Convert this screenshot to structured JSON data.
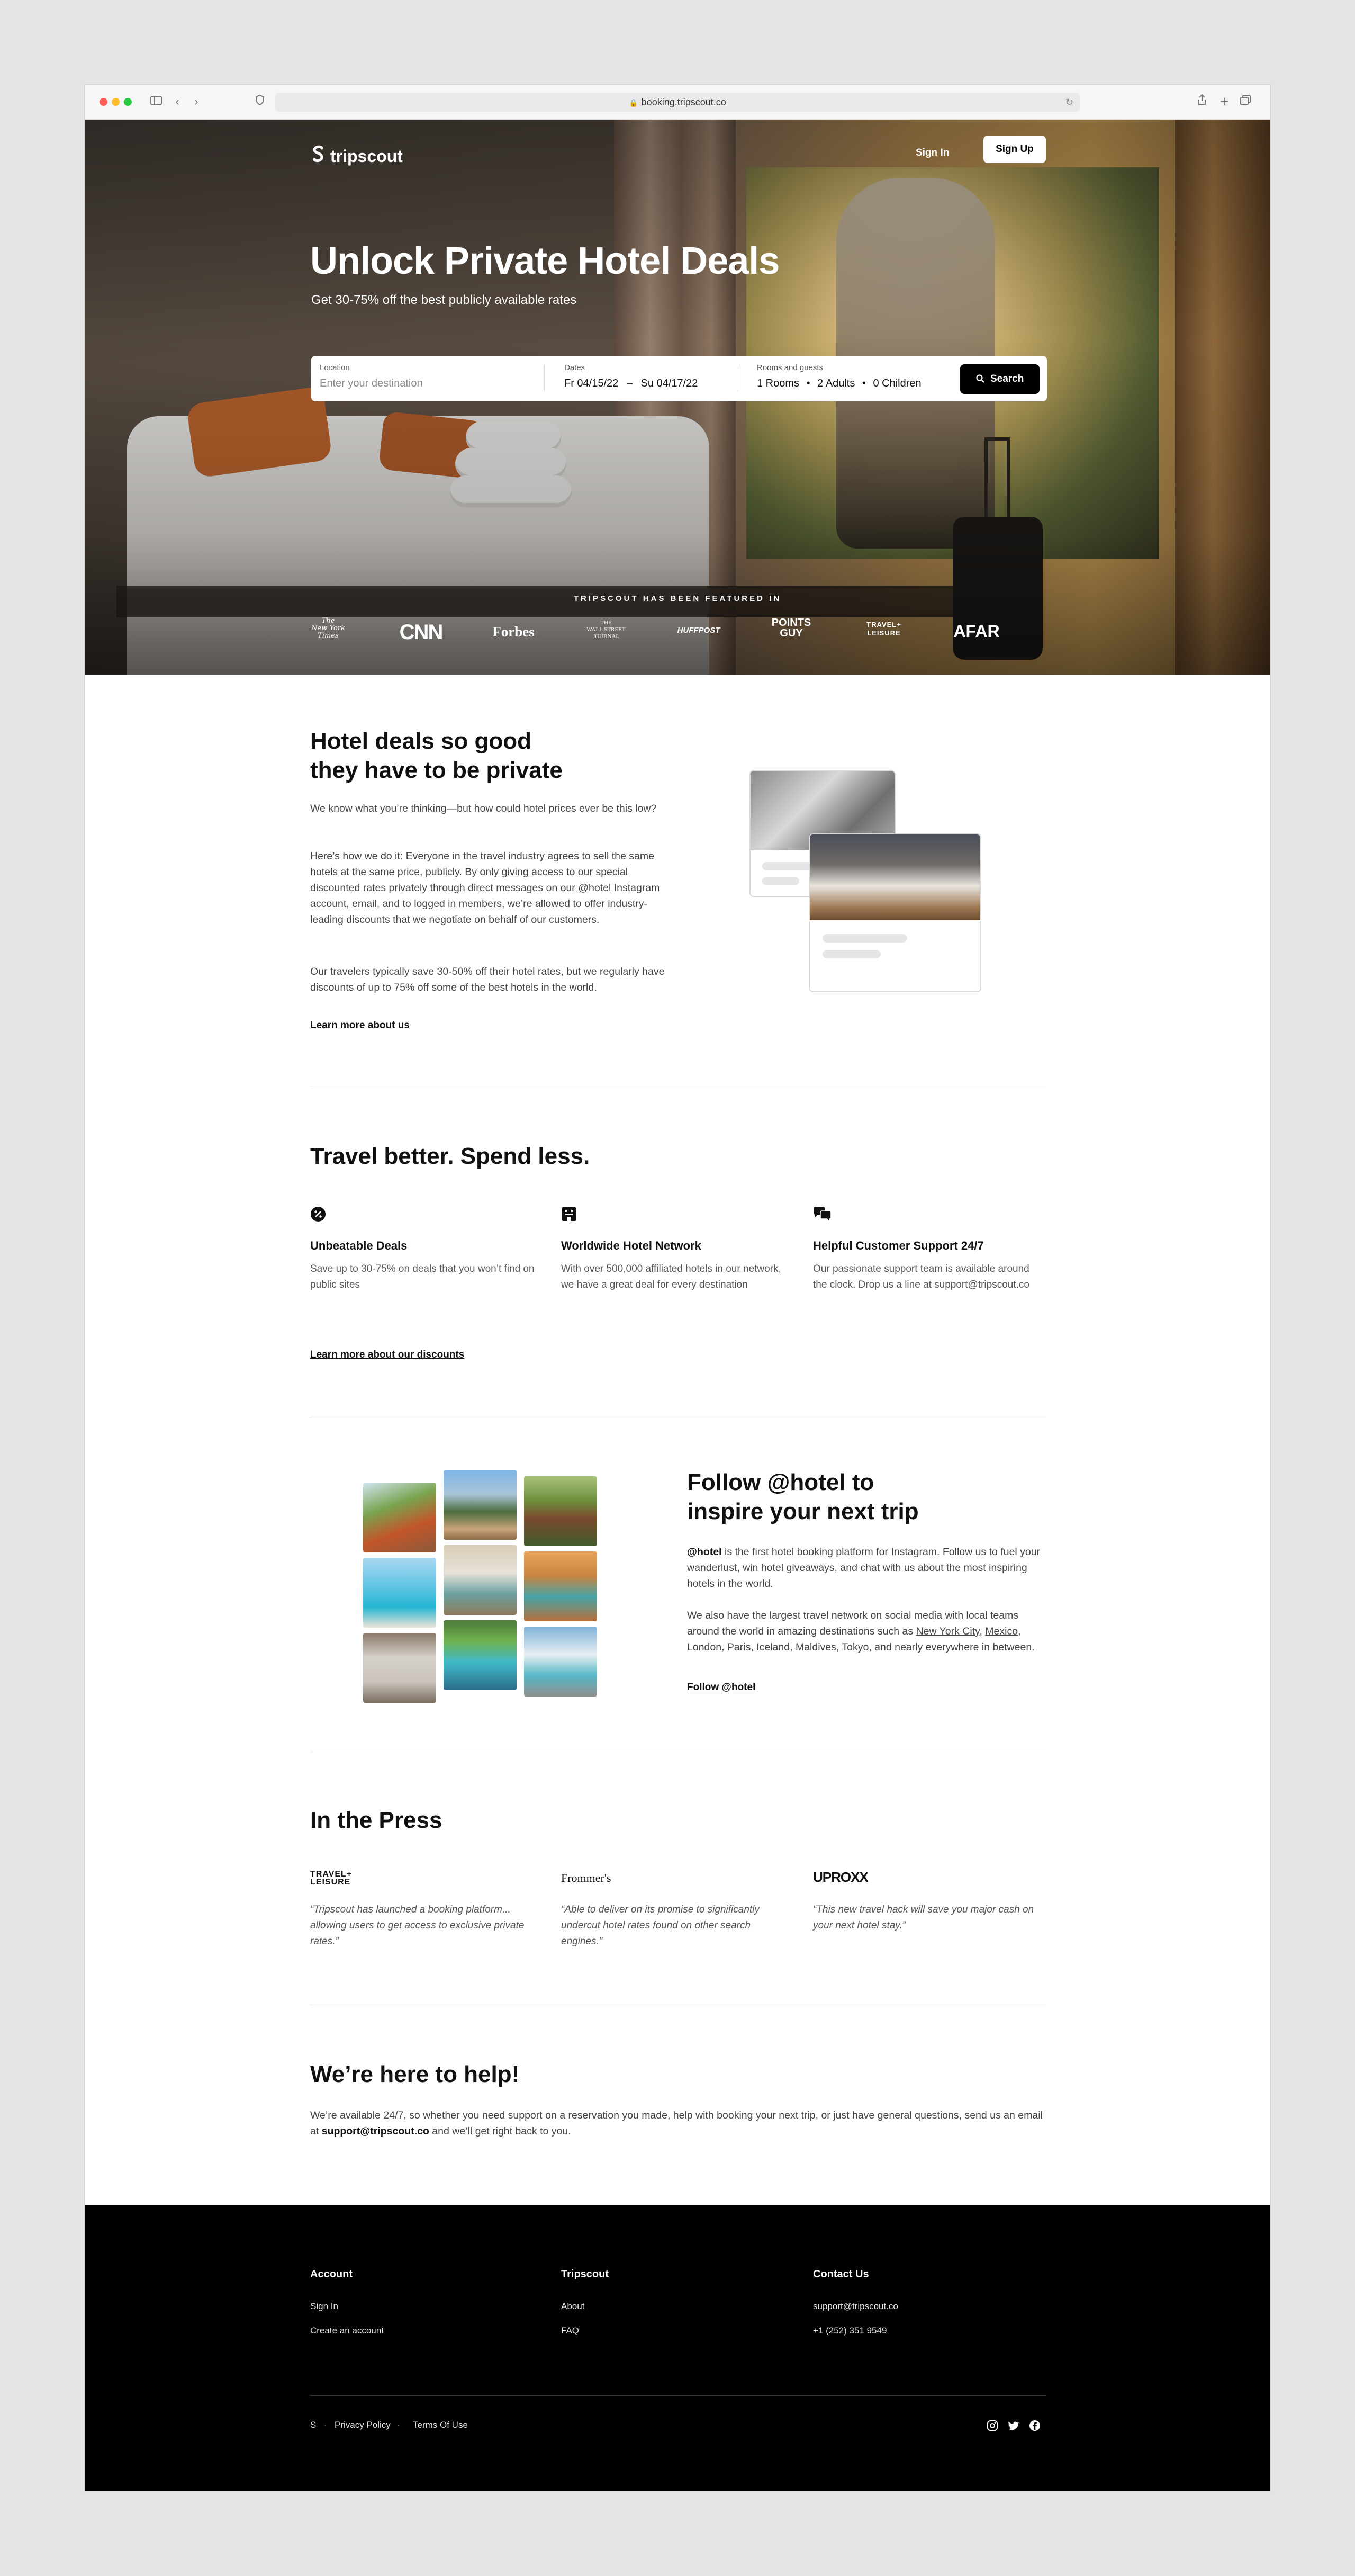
{
  "browser": {
    "url": "booking.tripscout.co"
  },
  "nav": {
    "brand": "tripscout",
    "signin": "Sign In",
    "signup": "Sign Up"
  },
  "hero": {
    "title": "Unlock Private Hotel Deals",
    "subtitle": "Get 30-75% off the best publicly available rates",
    "search": {
      "location_label": "Location",
      "location_placeholder": "Enter your destination",
      "dates_label": "Dates",
      "date_from": "Fr 04/15/22",
      "date_sep": "–",
      "date_to": "Su 04/17/22",
      "guests_label": "Rooms and guests",
      "rooms": "1 Rooms",
      "adults": "2 Adults",
      "children": "0 Children",
      "button": "Search"
    },
    "featured_label": "TRIPSCOUT HAS BEEN FEATURED IN",
    "featured_logos": [
      "The New York Times",
      "CNN",
      "Forbes",
      "THE WALL STREET JOURNAL",
      "HUFFPOST",
      "THE POINTS GUY",
      "TRAVEL + LEISURE",
      "AFAR"
    ]
  },
  "about": {
    "title_line1": "Hotel deals so good",
    "title_line2": "they have to be private",
    "p1": "We know what you’re thinking—but how could hotel prices ever be this low?",
    "p2_a": "Here’s how we do it: Everyone in the travel industry agrees to sell the same hotels at the same price, publicly. By only giving access to our special discounted rates privately through direct messages on our ",
    "p2_handle": "@hotel",
    "p2_b": " Instagram account, email, and to logged in members, we’re allowed to offer industry-leading discounts that we negotiate on behalf of our customers.",
    "p3": "Our travelers typically save 30-50% off their hotel rates, but we regularly have discounts of up to 75% off some of the best hotels in the world.",
    "link": "Learn more about us"
  },
  "travel": {
    "title": "Travel better. Spend less.",
    "features": [
      {
        "icon": "discount-badge-icon",
        "title": "Unbeatable Deals",
        "text": "Save up to 30-75% on deals that you won’t find on public sites"
      },
      {
        "icon": "hotel-building-icon",
        "title": "Worldwide Hotel Network",
        "text": "With over 500,000 affiliated hotels in our network, we have a great deal for every destination"
      },
      {
        "icon": "chat-bubbles-icon",
        "title": "Helpful Customer Support 24/7",
        "text": "Our passionate support team is available around the clock. Drop us a line at support@tripscout.co"
      }
    ],
    "link": "Learn more about our discounts"
  },
  "follow": {
    "title_line1": "Follow @hotel to",
    "title_line2": "inspire your next trip",
    "p1_handle": "@hotel",
    "p1_rest": " is the first hotel booking platform for Instagram. Follow us to fuel your wanderlust, win hotel giveaways, and chat with us about the most inspiring hotels in the world.",
    "p2_a": "We also have the largest travel network on social media with local teams around the world in amazing destinations such as ",
    "cities": [
      "New York City",
      "Mexico",
      "London",
      "Paris",
      "Iceland",
      "Maldives",
      "Tokyo"
    ],
    "p2_b": ", and nearly everywhere in between.",
    "link": "Follow @hotel"
  },
  "press": {
    "title": "In the Press",
    "items": [
      {
        "logo": "TRAVEL+ LEISURE",
        "quote": "“Tripscout has launched a booking platform... allowing users to get access to exclusive private rates.”"
      },
      {
        "logo": "Frommer's",
        "quote": "“Able to deliver on its promise to significantly undercut hotel rates found on other search engines.”"
      },
      {
        "logo": "UPROXX",
        "quote": "“This new travel hack will save you major cash on your next hotel stay.”"
      }
    ]
  },
  "help": {
    "title": "We’re here to help!",
    "p_a": "We’re available 24/7, so whether you need support on a reservation you made, help with booking your next trip, or just have general questions, send us an email at ",
    "email": "support@tripscout.co",
    "p_b": " and we’ll get right back to you."
  },
  "footer": {
    "account": {
      "title": "Account",
      "links": [
        "Sign In",
        "Create an account"
      ]
    },
    "tripscout": {
      "title": "Tripscout",
      "links": [
        "About",
        "FAQ"
      ]
    },
    "contact": {
      "title": "Contact Us",
      "links": [
        "support@tripscout.co",
        "+1 (252) 351 9549"
      ]
    },
    "brand_glyph": "S",
    "sep": "·",
    "privacy": "Privacy Policy",
    "terms": "Terms Of Use"
  }
}
